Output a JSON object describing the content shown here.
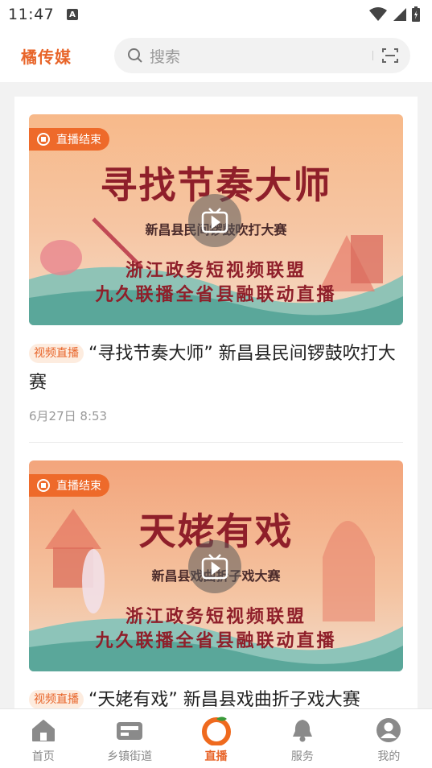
{
  "status_bar": {
    "time": "11:47",
    "notification_badge": "A"
  },
  "app_bar": {
    "logo": "橘传媒",
    "search_placeholder": "搜索"
  },
  "feed": [
    {
      "live_status": "直播结束",
      "poster_title": "寻找节奏大师",
      "poster_subtitle": "新昌县民间锣鼓吹打大赛",
      "poster_line1": "浙江政务短视频联盟",
      "poster_line2": "九久联播全省县融联动直播",
      "tag": "视频直播",
      "headline": "“寻找节奏大师” 新昌县民间锣鼓吹打大赛",
      "time": "6月27日 8:53"
    },
    {
      "live_status": "直播结束",
      "poster_title": "天姥有戏",
      "poster_subtitle": "新昌县戏曲折子戏大赛",
      "poster_line1": "浙江政务短视频联盟",
      "poster_line2": "九久联播全省县融联动直播",
      "tag": "视频直播",
      "headline": "“天姥有戏” 新昌县戏曲折子戏大赛",
      "time": ""
    }
  ],
  "tab_bar": {
    "items": [
      {
        "label": "首页",
        "icon": "home-icon"
      },
      {
        "label": "乡镇街道",
        "icon": "wallet-icon"
      },
      {
        "label": "直播",
        "icon": "orange-icon",
        "active": true
      },
      {
        "label": "服务",
        "icon": "bell-icon"
      },
      {
        "label": "我的",
        "icon": "profile-icon"
      }
    ]
  },
  "colors": {
    "accent": "#e8652a",
    "poster_title": "#8f1f2a"
  }
}
